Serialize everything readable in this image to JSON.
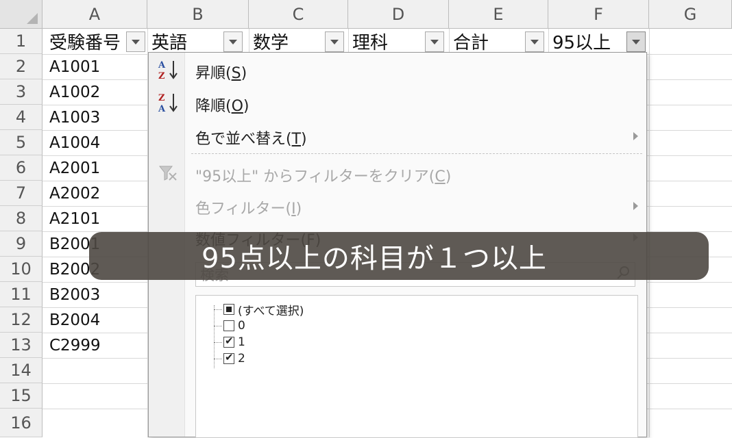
{
  "columns": [
    "A",
    "B",
    "C",
    "D",
    "E",
    "F",
    "G"
  ],
  "rows": [
    "1",
    "2",
    "3",
    "4",
    "5",
    "6",
    "7",
    "8",
    "9",
    "10",
    "11",
    "12",
    "13",
    "14",
    "15",
    "16"
  ],
  "header_row": [
    "受験番号",
    "英語",
    "数学",
    "理科",
    "合計",
    "95以上"
  ],
  "column_a": [
    "A1001",
    "A1002",
    "A1003",
    "A1004",
    "A2001",
    "A2002",
    "A2101",
    "B2001",
    "B2002",
    "B2003",
    "B2004",
    "C2999"
  ],
  "menu": {
    "sort_asc_pre": "昇順(",
    "sort_asc_key": "S",
    "sort_asc_post": ")",
    "sort_desc_pre": "降順(",
    "sort_desc_key": "O",
    "sort_desc_post": ")",
    "sort_color_pre": "色で並べ替え(",
    "sort_color_key": "T",
    "sort_color_post": ")",
    "clear_pre": "\"95以上\" からフィルターをクリア(",
    "clear_key": "C",
    "clear_post": ")",
    "color_filter_pre": "色フィルター(",
    "color_filter_key": "I",
    "color_filter_post": ")",
    "number_filter": "数値フィルター(F)",
    "search_placeholder": "検索",
    "select_all": "(すべて選択)",
    "values": [
      "0",
      "1",
      "2"
    ]
  },
  "overlay_caption": "95点以上の科目が１つ以上",
  "icons": {
    "sort_asc": "sort-az-icon",
    "sort_desc": "sort-za-icon",
    "clear_filter": "clear-filter-icon",
    "search": "search-icon"
  }
}
